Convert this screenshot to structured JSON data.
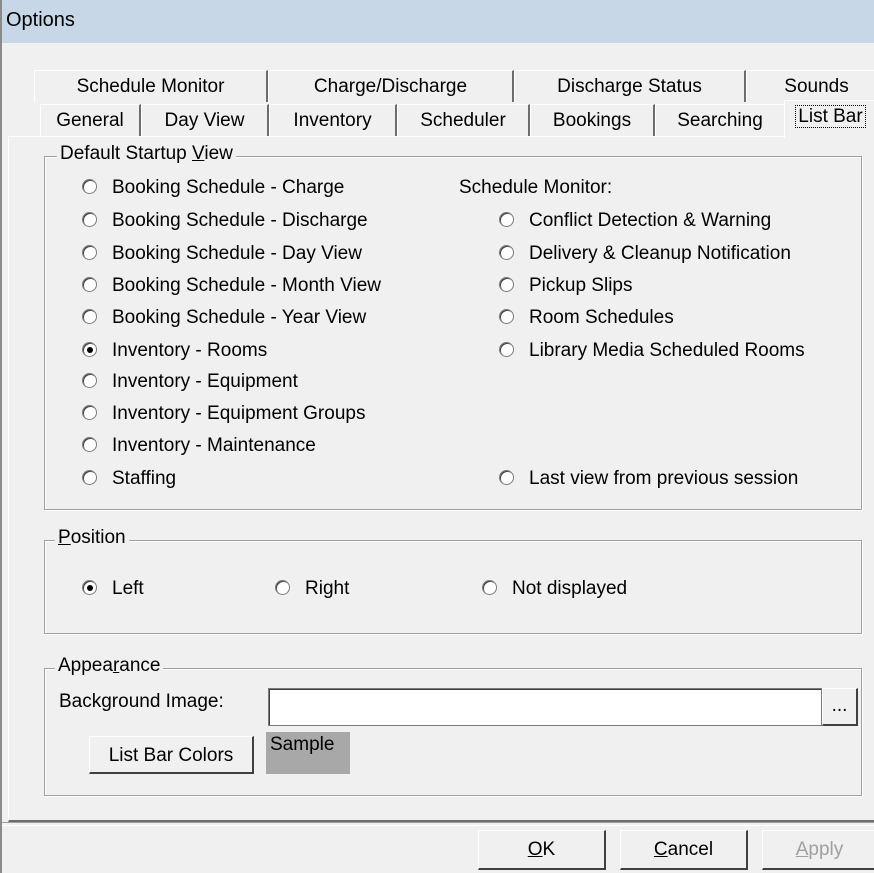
{
  "window": {
    "title": "Options"
  },
  "tabs_back": [
    {
      "label": "Schedule Monitor"
    },
    {
      "label": "Charge/Discharge"
    },
    {
      "label": "Discharge Status"
    },
    {
      "label": "Sounds"
    }
  ],
  "tabs_front": [
    {
      "label": "General"
    },
    {
      "label": "Day View"
    },
    {
      "label": "Inventory"
    },
    {
      "label": "Scheduler"
    },
    {
      "label": "Bookings"
    },
    {
      "label": "Searching"
    },
    {
      "label": "List Bar",
      "selected": true
    }
  ],
  "startup": {
    "legend_pre": "Default Startup ",
    "legend_key": "V",
    "legend_post": "iew",
    "options": [
      {
        "label": "Booking Schedule - Charge",
        "checked": false
      },
      {
        "label": "Booking Schedule - Discharge",
        "checked": false
      },
      {
        "label": "Booking Schedule - Day View",
        "checked": false
      },
      {
        "label": "Booking Schedule - Month View",
        "checked": false
      },
      {
        "label": "Booking Schedule - Year View",
        "checked": false
      },
      {
        "label": "Inventory - Rooms",
        "checked": true
      },
      {
        "label": "Inventory - Equipment",
        "checked": false
      },
      {
        "label": "Inventory - Equipment Groups",
        "checked": false
      },
      {
        "label": "Inventory - Maintenance",
        "checked": false
      },
      {
        "label": "Staffing",
        "checked": false
      }
    ],
    "monitor_heading": "Schedule Monitor:",
    "monitor_options": [
      {
        "label": "Conflict Detection & Warning",
        "checked": false
      },
      {
        "label": "Delivery & Cleanup Notification",
        "checked": false
      },
      {
        "label": "Pickup Slips",
        "checked": false
      },
      {
        "label": "Room Schedules",
        "checked": false
      },
      {
        "label": "Library Media Scheduled Rooms",
        "checked": false
      }
    ],
    "last_view": {
      "label": "Last view from previous session",
      "checked": false
    }
  },
  "position": {
    "legend_key": "P",
    "legend_post": "osition",
    "options": [
      {
        "label": "Left",
        "checked": true
      },
      {
        "label": "Right",
        "checked": false
      },
      {
        "label": "Not displayed",
        "checked": false
      }
    ]
  },
  "appearance": {
    "legend_pre": "Appea",
    "legend_key": "r",
    "legend_post": "ance",
    "bg_label": "Background Image:",
    "bg_value": "",
    "browse_label": "...",
    "colors_button": "List Bar Colors",
    "sample": "Sample"
  },
  "buttons": {
    "ok_key": "O",
    "ok_post": "K",
    "cancel_key": "C",
    "cancel_post": "ancel",
    "apply_key": "A",
    "apply_post": "pply"
  }
}
